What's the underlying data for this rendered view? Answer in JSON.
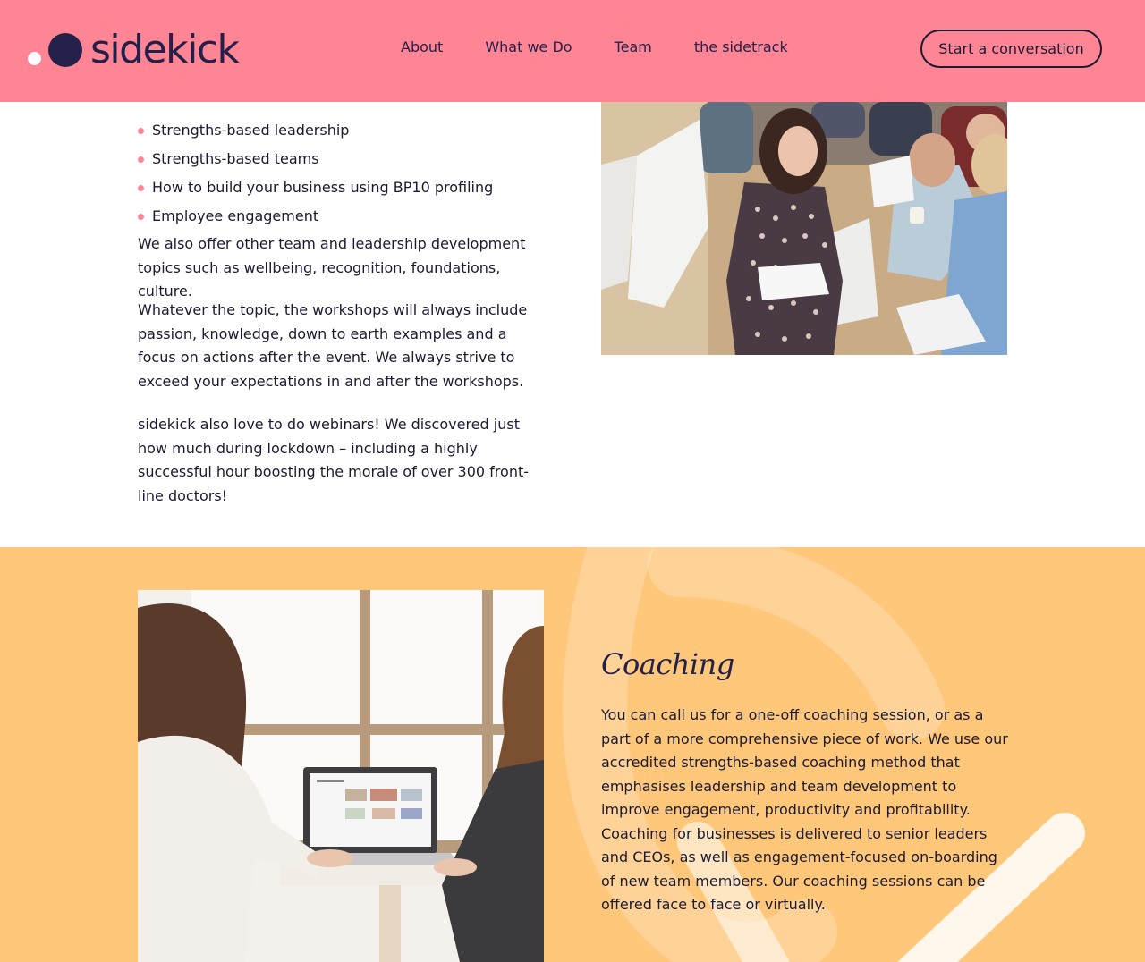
{
  "header": {
    "logo_text": "sidekick",
    "nav": [
      "About",
      "What we Do",
      "Team",
      "the sidetrack"
    ],
    "cta_label": "Start a conversation",
    "bg_color": "#ff8595",
    "brand_color": "#23214a"
  },
  "workshops": {
    "bullets": [
      "Strengths-based leadership",
      "Strengths-based teams",
      "How to build your business using BP10 profiling",
      "Employee engagement"
    ],
    "paragraphs": [
      "We also offer other team and leadership development topics such as wellbeing, recognition, foundations, culture.",
      "Whatever the topic, the workshops will always include passion, knowledge, down to earth examples and a focus on actions after the event. We always strive to exceed your expectations in and after the workshops.",
      "sidekick also love to do webinars! We discovered just how much during lockdown – including a highly successful hour boosting the morale of over 300 front-line doctors!"
    ]
  },
  "coaching": {
    "title": "Coaching",
    "text": "You can call us for a one-off coaching session, or as a part of a more comprehensive piece of work. We use our accredited strengths-based coaching method that emphasises leadership and team development to improve engagement, productivity and profitability. Coaching for businesses is delivered to senior leaders and CEOs, as well as engagement-focused on-boarding of new team members. Our coaching sessions can be offered face to face or virtually.",
    "bg_color": "#ffc77a"
  }
}
